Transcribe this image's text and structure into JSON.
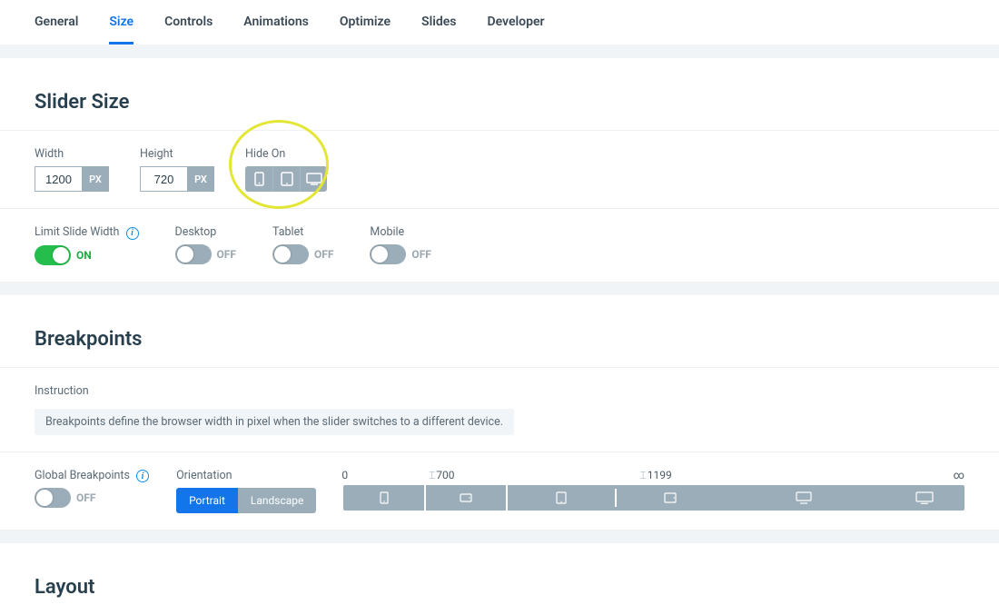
{
  "tabs": {
    "general": "General",
    "size": "Size",
    "controls": "Controls",
    "animations": "Animations",
    "optimize": "Optimize",
    "slides": "Slides",
    "developer": "Developer"
  },
  "slider_size": {
    "title": "Slider Size",
    "width_label": "Width",
    "width_value": "1200",
    "width_unit": "PX",
    "height_label": "Height",
    "height_value": "720",
    "height_unit": "PX",
    "hide_on_label": "Hide On",
    "limit_width_label": "Limit Slide Width",
    "limit_width_state": "ON",
    "desktop_label": "Desktop",
    "desktop_state": "OFF",
    "tablet_label": "Tablet",
    "tablet_state": "OFF",
    "mobile_label": "Mobile",
    "mobile_state": "OFF"
  },
  "breakpoints": {
    "title": "Breakpoints",
    "instruction_label": "Instruction",
    "instruction_text": "Breakpoints define the browser width in pixel when the slider switches to a different device.",
    "global_label": "Global Breakpoints",
    "global_state": "OFF",
    "orientation_label": "Orientation",
    "portrait": "Portrait",
    "landscape": "Landscape",
    "p0": "0",
    "p1": "700",
    "p2": "1199",
    "p_inf": "∞"
  },
  "layout": {
    "title": "Layout"
  }
}
